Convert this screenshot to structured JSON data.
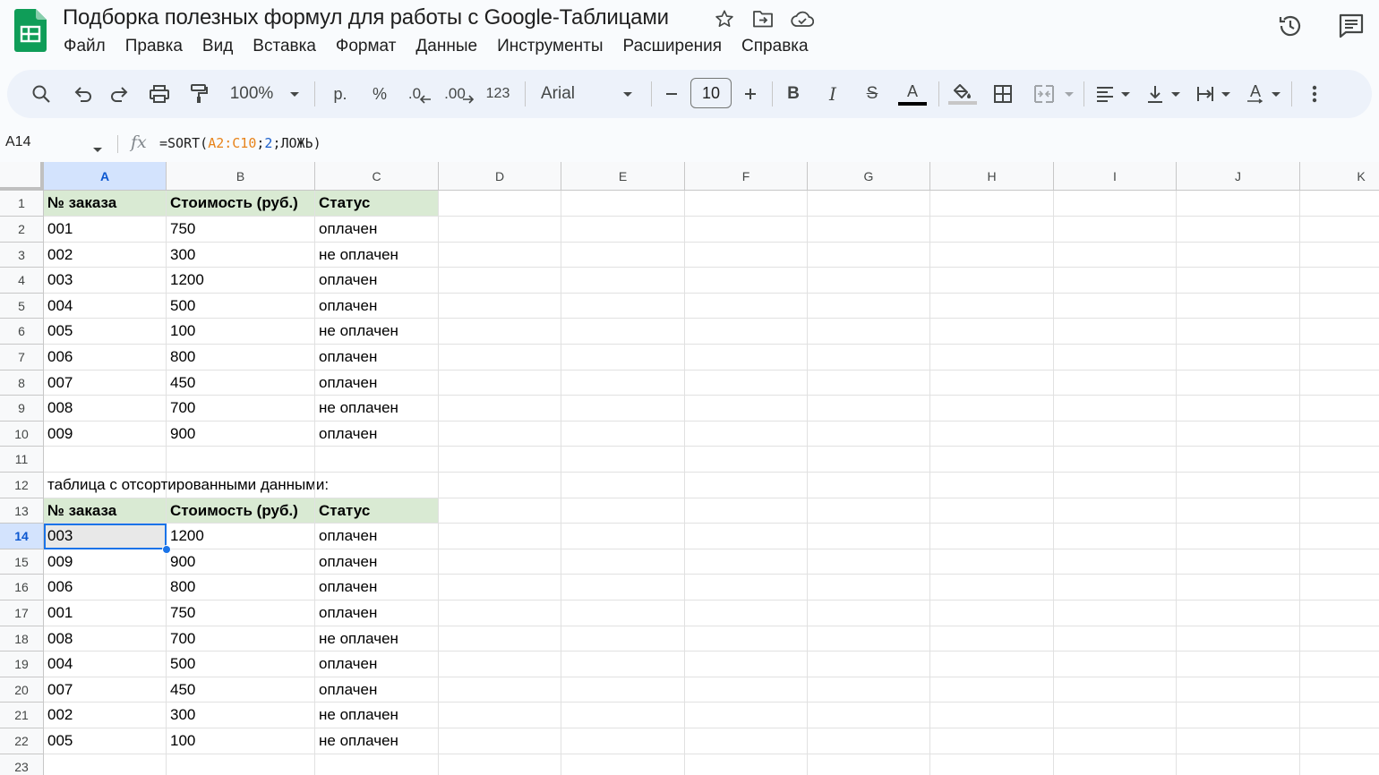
{
  "document": {
    "title": "Подборка полезных формул для работы с Google-Таблицами"
  },
  "menu": [
    "Файл",
    "Правка",
    "Вид",
    "Вставка",
    "Формат",
    "Данные",
    "Инструменты",
    "Расширения",
    "Справка"
  ],
  "toolbar": {
    "zoom": "100%",
    "currency": "р.",
    "percent": "%",
    "decrease_decimal": ".0",
    "increase_decimal": ".00",
    "number_format": "123",
    "font_family": "Arial",
    "font_size": "10",
    "bold": "B",
    "italic": "I",
    "strikethrough": "S",
    "text_color_glyph": "A",
    "text_rotate_glyph": "A"
  },
  "formula_bar": {
    "cell_ref": "A14",
    "fx": "fx",
    "formula_prefix": "=SORT(",
    "formula_range": "A2:C10",
    "formula_sep1": ";",
    "formula_num": "2",
    "formula_suffix": ";ЛОЖЬ)"
  },
  "sheet": {
    "selected_cell": "A14",
    "columns": [
      "A",
      "B",
      "C",
      "D",
      "E",
      "F",
      "G",
      "H",
      "I",
      "J",
      "K"
    ],
    "rows": [
      {
        "n": "1",
        "cells": [
          "№ заказа",
          "Стоимость (руб.)",
          "Статус"
        ],
        "header": true
      },
      {
        "n": "2",
        "cells": [
          "001",
          "750",
          "оплачен"
        ]
      },
      {
        "n": "3",
        "cells": [
          "002",
          "300",
          "не оплачен"
        ]
      },
      {
        "n": "4",
        "cells": [
          "003",
          "1200",
          "оплачен"
        ]
      },
      {
        "n": "5",
        "cells": [
          "004",
          "500",
          "оплачен"
        ]
      },
      {
        "n": "6",
        "cells": [
          "005",
          "100",
          "не оплачен"
        ]
      },
      {
        "n": "7",
        "cells": [
          "006",
          "800",
          "оплачен"
        ]
      },
      {
        "n": "8",
        "cells": [
          "007",
          "450",
          "оплачен"
        ]
      },
      {
        "n": "9",
        "cells": [
          "008",
          "700",
          "не оплачен"
        ]
      },
      {
        "n": "10",
        "cells": [
          "009",
          "900",
          "оплачен"
        ]
      },
      {
        "n": "11",
        "cells": [
          "",
          "",
          ""
        ]
      },
      {
        "n": "12",
        "cells": [
          "таблица с отсортированными данными:",
          "",
          ""
        ]
      },
      {
        "n": "13",
        "cells": [
          "№ заказа",
          "Стоимость (руб.)",
          "Статус"
        ],
        "header": true
      },
      {
        "n": "14",
        "cells": [
          "003",
          "1200",
          "оплачен"
        ]
      },
      {
        "n": "15",
        "cells": [
          "009",
          "900",
          "оплачен"
        ]
      },
      {
        "n": "16",
        "cells": [
          "006",
          "800",
          "оплачен"
        ]
      },
      {
        "n": "17",
        "cells": [
          "001",
          "750",
          "оплачен"
        ]
      },
      {
        "n": "18",
        "cells": [
          "008",
          "700",
          "не оплачен"
        ]
      },
      {
        "n": "19",
        "cells": [
          "004",
          "500",
          "оплачен"
        ]
      },
      {
        "n": "20",
        "cells": [
          "007",
          "450",
          "оплачен"
        ]
      },
      {
        "n": "21",
        "cells": [
          "002",
          "300",
          "не оплачен"
        ]
      },
      {
        "n": "22",
        "cells": [
          "005",
          "100",
          "не оплачен"
        ]
      },
      {
        "n": "23",
        "cells": [
          "",
          "",
          ""
        ]
      }
    ]
  },
  "colors": {
    "accent": "#1a73e8",
    "header_fill": "#d9ead3",
    "logo_green": "#0f9d58",
    "formula_range": "#e7831a",
    "formula_number": "#1b5fcb"
  }
}
